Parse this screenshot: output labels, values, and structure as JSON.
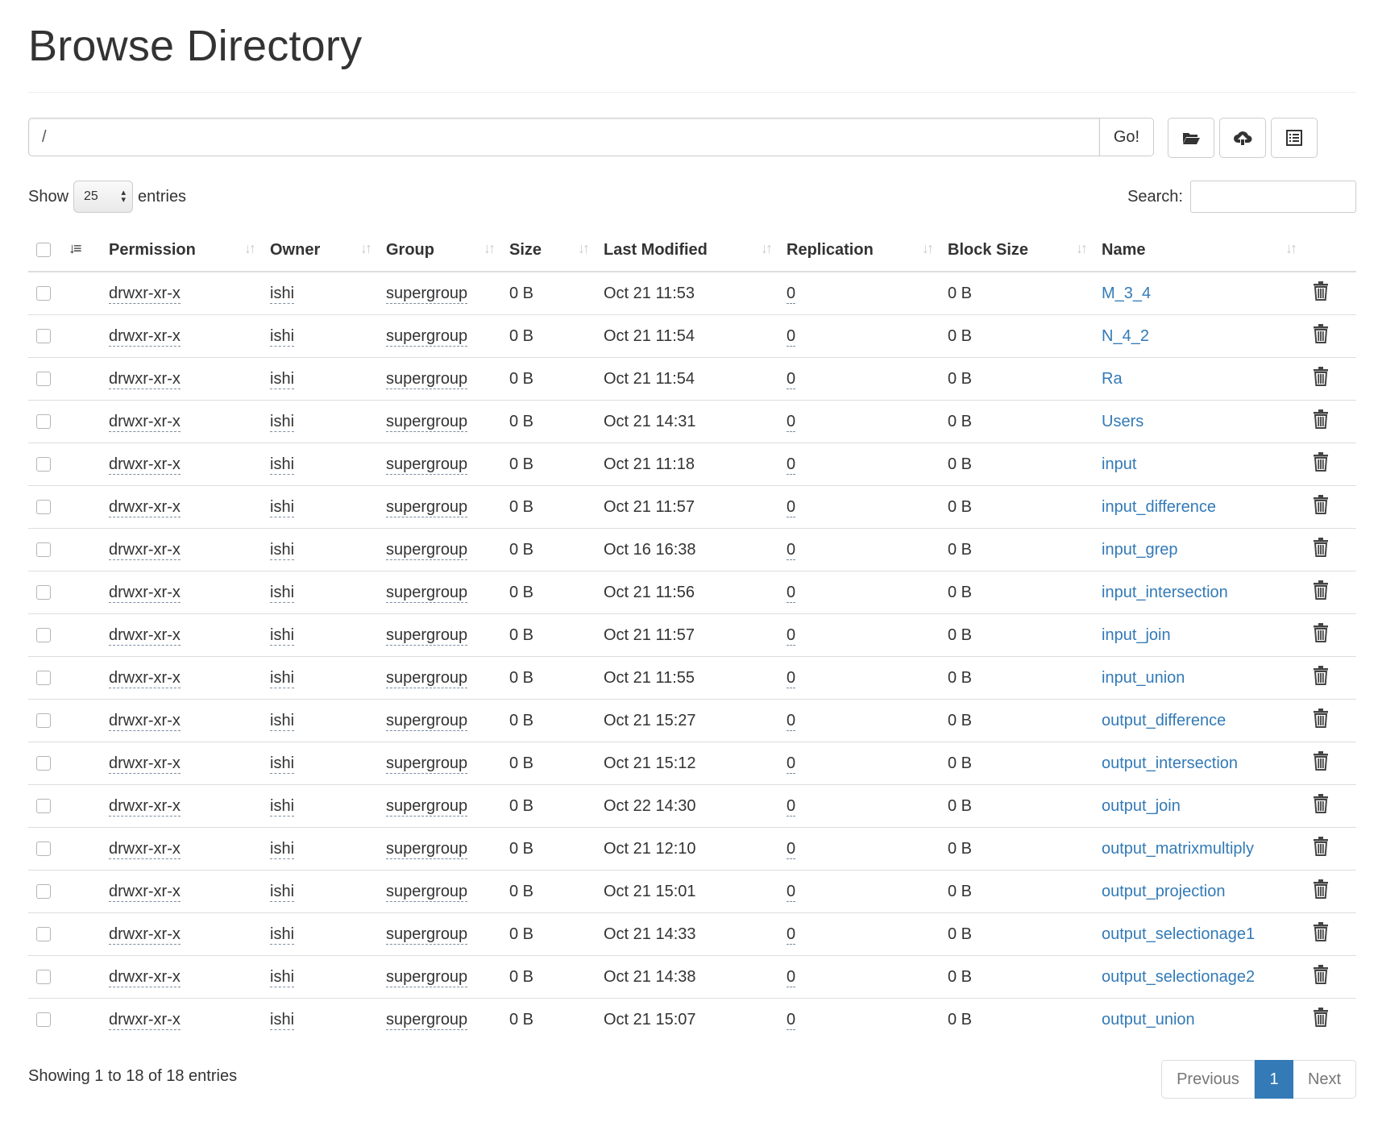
{
  "page": {
    "title": "Browse Directory"
  },
  "pathbar": {
    "path_value": "/",
    "go_label": "Go!",
    "tools": [
      "folder-open-icon",
      "cloud-upload-icon",
      "list-alt-icon"
    ]
  },
  "length_control": {
    "show_label": "Show",
    "selected": "25",
    "entries_label": "entries"
  },
  "search": {
    "label": "Search:",
    "value": ""
  },
  "table": {
    "columns": [
      "Permission",
      "Owner",
      "Group",
      "Size",
      "Last Modified",
      "Replication",
      "Block Size",
      "Name"
    ],
    "rows": [
      {
        "permission": "drwxr-xr-x",
        "owner": "ishi",
        "group": "supergroup",
        "size": "0 B",
        "modified": "Oct 21 11:53",
        "replication": "0",
        "block_size": "0 B",
        "name": "M_3_4"
      },
      {
        "permission": "drwxr-xr-x",
        "owner": "ishi",
        "group": "supergroup",
        "size": "0 B",
        "modified": "Oct 21 11:54",
        "replication": "0",
        "block_size": "0 B",
        "name": "N_4_2"
      },
      {
        "permission": "drwxr-xr-x",
        "owner": "ishi",
        "group": "supergroup",
        "size": "0 B",
        "modified": "Oct 21 11:54",
        "replication": "0",
        "block_size": "0 B",
        "name": "Ra"
      },
      {
        "permission": "drwxr-xr-x",
        "owner": "ishi",
        "group": "supergroup",
        "size": "0 B",
        "modified": "Oct 21 14:31",
        "replication": "0",
        "block_size": "0 B",
        "name": "Users"
      },
      {
        "permission": "drwxr-xr-x",
        "owner": "ishi",
        "group": "supergroup",
        "size": "0 B",
        "modified": "Oct 21 11:18",
        "replication": "0",
        "block_size": "0 B",
        "name": "input"
      },
      {
        "permission": "drwxr-xr-x",
        "owner": "ishi",
        "group": "supergroup",
        "size": "0 B",
        "modified": "Oct 21 11:57",
        "replication": "0",
        "block_size": "0 B",
        "name": "input_difference"
      },
      {
        "permission": "drwxr-xr-x",
        "owner": "ishi",
        "group": "supergroup",
        "size": "0 B",
        "modified": "Oct 16 16:38",
        "replication": "0",
        "block_size": "0 B",
        "name": "input_grep"
      },
      {
        "permission": "drwxr-xr-x",
        "owner": "ishi",
        "group": "supergroup",
        "size": "0 B",
        "modified": "Oct 21 11:56",
        "replication": "0",
        "block_size": "0 B",
        "name": "input_intersection"
      },
      {
        "permission": "drwxr-xr-x",
        "owner": "ishi",
        "group": "supergroup",
        "size": "0 B",
        "modified": "Oct 21 11:57",
        "replication": "0",
        "block_size": "0 B",
        "name": "input_join"
      },
      {
        "permission": "drwxr-xr-x",
        "owner": "ishi",
        "group": "supergroup",
        "size": "0 B",
        "modified": "Oct 21 11:55",
        "replication": "0",
        "block_size": "0 B",
        "name": "input_union"
      },
      {
        "permission": "drwxr-xr-x",
        "owner": "ishi",
        "group": "supergroup",
        "size": "0 B",
        "modified": "Oct 21 15:27",
        "replication": "0",
        "block_size": "0 B",
        "name": "output_difference"
      },
      {
        "permission": "drwxr-xr-x",
        "owner": "ishi",
        "group": "supergroup",
        "size": "0 B",
        "modified": "Oct 21 15:12",
        "replication": "0",
        "block_size": "0 B",
        "name": "output_intersection"
      },
      {
        "permission": "drwxr-xr-x",
        "owner": "ishi",
        "group": "supergroup",
        "size": "0 B",
        "modified": "Oct 22 14:30",
        "replication": "0",
        "block_size": "0 B",
        "name": "output_join"
      },
      {
        "permission": "drwxr-xr-x",
        "owner": "ishi",
        "group": "supergroup",
        "size": "0 B",
        "modified": "Oct 21 12:10",
        "replication": "0",
        "block_size": "0 B",
        "name": "output_matrixmultiply"
      },
      {
        "permission": "drwxr-xr-x",
        "owner": "ishi",
        "group": "supergroup",
        "size": "0 B",
        "modified": "Oct 21 15:01",
        "replication": "0",
        "block_size": "0 B",
        "name": "output_projection"
      },
      {
        "permission": "drwxr-xr-x",
        "owner": "ishi",
        "group": "supergroup",
        "size": "0 B",
        "modified": "Oct 21 14:33",
        "replication": "0",
        "block_size": "0 B",
        "name": "output_selectionage1"
      },
      {
        "permission": "drwxr-xr-x",
        "owner": "ishi",
        "group": "supergroup",
        "size": "0 B",
        "modified": "Oct 21 14:38",
        "replication": "0",
        "block_size": "0 B",
        "name": "output_selectionage2"
      },
      {
        "permission": "drwxr-xr-x",
        "owner": "ishi",
        "group": "supergroup",
        "size": "0 B",
        "modified": "Oct 21 15:07",
        "replication": "0",
        "block_size": "0 B",
        "name": "output_union"
      }
    ],
    "row_action_icon": "trash-icon"
  },
  "footer": {
    "info": "Showing 1 to 18 of 18 entries",
    "previous_label": "Previous",
    "current_page": "1",
    "next_label": "Next"
  },
  "colors": {
    "link": "#337ab7",
    "active_page": "#337ab7",
    "border": "#dddddd"
  }
}
